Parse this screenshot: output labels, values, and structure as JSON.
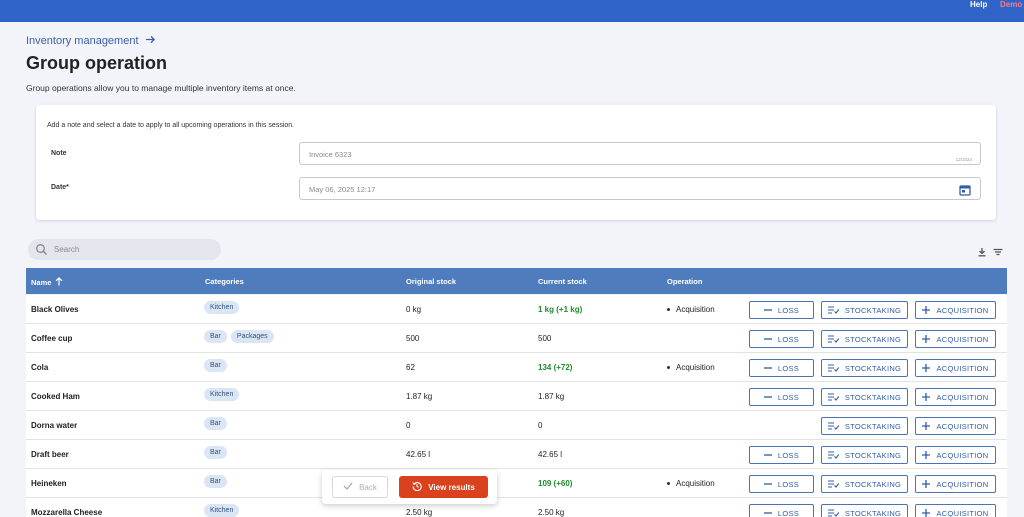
{
  "topbar": {
    "help": "Help",
    "demo": "Demo"
  },
  "breadcrumb": {
    "label": "Inventory management"
  },
  "page": {
    "title": "Group operation",
    "subtitle": "Group operations allow you to manage multiple inventory items at once."
  },
  "session_card": {
    "hint": "Add a note and select a date to apply to all upcoming operations in this session.",
    "note_label": "Note",
    "note_value": "Invoice 6323",
    "note_counter": "12/1024",
    "date_label": "Date*",
    "date_value": "May 06, 2025 12:17"
  },
  "search": {
    "placeholder": "Search"
  },
  "table": {
    "headers": {
      "name": "Name",
      "categories": "Categories",
      "original_stock": "Original stock",
      "current_stock": "Current stock",
      "operation": "Operation"
    },
    "rows": [
      {
        "name": "Black Olives",
        "categories": [
          "Kitchen"
        ],
        "original": "0 kg",
        "current": "1 kg (+1 kg)",
        "changed": true,
        "operation": "Acquisition"
      },
      {
        "name": "Coffee cup",
        "categories": [
          "Bar",
          "Packages"
        ],
        "original": "500",
        "current": "500",
        "changed": false,
        "operation": ""
      },
      {
        "name": "Cola",
        "categories": [
          "Bar"
        ],
        "original": "62",
        "current": "134 (+72)",
        "changed": true,
        "operation": "Acquisition"
      },
      {
        "name": "Cooked Ham",
        "categories": [
          "Kitchen"
        ],
        "original": "1.87 kg",
        "current": "1.87 kg",
        "changed": false,
        "operation": ""
      },
      {
        "name": "Dorna water",
        "categories": [
          "Bar"
        ],
        "original": "0",
        "current": "0",
        "changed": false,
        "operation": ""
      },
      {
        "name": "Draft beer",
        "categories": [
          "Bar"
        ],
        "original": "42.65 l",
        "current": "42.65 l",
        "changed": false,
        "operation": ""
      },
      {
        "name": "Heineken",
        "categories": [
          "Bar"
        ],
        "original": "",
        "current": "109 (+60)",
        "changed": true,
        "operation": "Acquisition"
      },
      {
        "name": "Mozzarella Cheese",
        "categories": [
          "Kitchen"
        ],
        "original": "2.50 kg",
        "current": "2.50 kg",
        "changed": false,
        "operation": ""
      }
    ],
    "row_buttons": {
      "loss": "LOSS",
      "stocktaking": "STOCKTAKING",
      "acquisition": "ACQUISITION"
    },
    "loss_visible": [
      true,
      true,
      true,
      true,
      false,
      true,
      true,
      true
    ]
  },
  "floatbar": {
    "back": "Back",
    "view_results": "View results"
  },
  "colors": {
    "accent": "#2f63c7",
    "header": "#4f7cbd",
    "primary_action": "#d9421c",
    "positive": "#1f8a2e"
  },
  "icons": [
    "arrow-right-icon",
    "search-icon",
    "download-icon",
    "filter-icon",
    "sort-up-icon",
    "calendar-icon",
    "minus-icon",
    "list-check-icon",
    "plus-icon",
    "check-icon",
    "history-icon"
  ]
}
